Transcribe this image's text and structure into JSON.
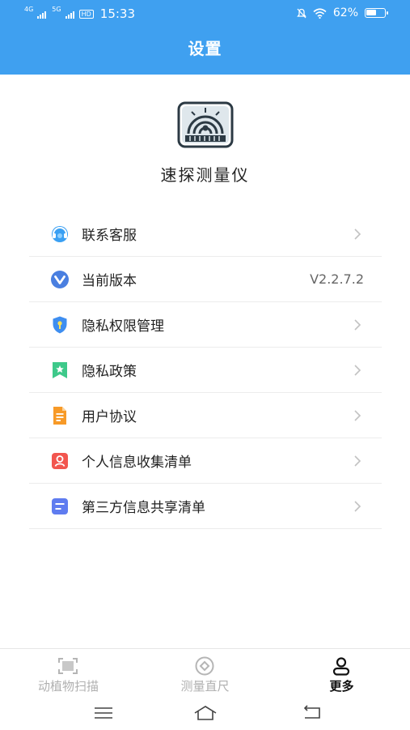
{
  "status_bar": {
    "network_1": "4G",
    "network_2": "5G",
    "hd": "HD",
    "time": "15:33",
    "battery": "62%",
    "battery_level": 0.62
  },
  "header": {
    "title": "设置",
    "background_color": "#3fa0f0"
  },
  "app": {
    "name": "速探测量仪",
    "logo_icon": "radar-scanner-logo-icon"
  },
  "menu": {
    "items": [
      {
        "label": "联系客服",
        "icon": "customer-service-icon",
        "value": ""
      },
      {
        "label": "当前版本",
        "icon": "version-icon",
        "value": "V2.2.7.2"
      },
      {
        "label": "隐私权限管理",
        "icon": "privacy-shield-icon",
        "value": ""
      },
      {
        "label": "隐私政策",
        "icon": "policy-bookmark-icon",
        "value": ""
      },
      {
        "label": "用户协议",
        "icon": "agreement-document-icon",
        "value": ""
      },
      {
        "label": "个人信息收集清单",
        "icon": "personal-info-icon",
        "value": ""
      },
      {
        "label": "第三方信息共享清单",
        "icon": "third-party-list-icon",
        "value": ""
      }
    ]
  },
  "tabs": [
    {
      "label": "动植物扫描",
      "icon": "scan-frame-icon",
      "active": false
    },
    {
      "label": "测量直尺",
      "icon": "ruler-eye-icon",
      "active": false
    },
    {
      "label": "更多",
      "icon": "person-icon",
      "active": true
    }
  ],
  "system_nav": [
    "menu-icon",
    "home-icon",
    "back-icon"
  ]
}
